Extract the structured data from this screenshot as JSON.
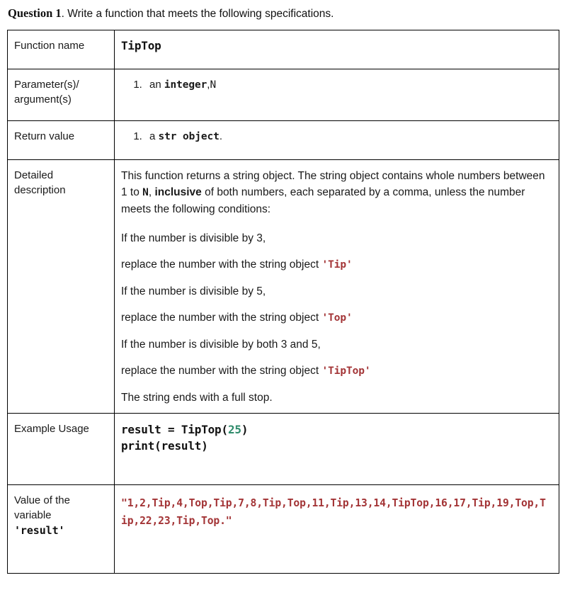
{
  "heading": {
    "question_label": "Question 1",
    "rest": ". Write a function that meets the following specifications."
  },
  "colors": {
    "string_literal": "#A33436",
    "number_literal": "#2E8B6B",
    "text": "#1a1a1a",
    "border": "#000000"
  },
  "table": {
    "function_name": {
      "label": "Function name",
      "value": "TipTop"
    },
    "parameters": {
      "label_line1": "Parameter(s)/",
      "label_line2": "argument(s)",
      "items": [
        {
          "prefix": "an ",
          "type": "integer",
          "separator": ",",
          "name": "N"
        }
      ]
    },
    "return_value": {
      "label": "Return value",
      "items": [
        {
          "prefix": "a ",
          "type": "str object",
          "suffix": "."
        }
      ]
    },
    "detailed_description": {
      "label_line1": "Detailed",
      "label_line2": "description",
      "intro_part1": "This function returns a string object. The string object contains whole numbers between 1 to ",
      "intro_n": "N",
      "intro_part2": ", ",
      "intro_bold": "inclusive",
      "intro_part3": " of both numbers, each separated by a comma, unless the number meets the following conditions:",
      "conditions": [
        {
          "if_text": "If the number is divisible by 3,",
          "then_text": "replace the number with the string object ",
          "literal": "'Tip'"
        },
        {
          "if_text": "If the number is divisible by 5,",
          "then_text": "replace the number with the string object ",
          "literal": "'Top'"
        },
        {
          "if_text": "If the number is divisible by both 3 and 5,",
          "then_text": "replace the number with the string object ",
          "literal": "'TipTop'"
        }
      ],
      "closing": "The string ends with a full stop."
    },
    "example_usage": {
      "label": "Example Usage",
      "code_line1_before": "result = TipTop(",
      "code_line1_number": "25",
      "code_line1_after": ")",
      "code_line2": "print(result)"
    },
    "result_value": {
      "label_line1": "Value of the",
      "label_line2": "variable",
      "label_var": "'result'",
      "value": "\"1,2,Tip,4,Top,Tip,7,8,Tip,Top,11,Tip,13,14,TipTop,16,17,Tip,19,Top,Tip,22,23,Tip,Top.\""
    }
  }
}
